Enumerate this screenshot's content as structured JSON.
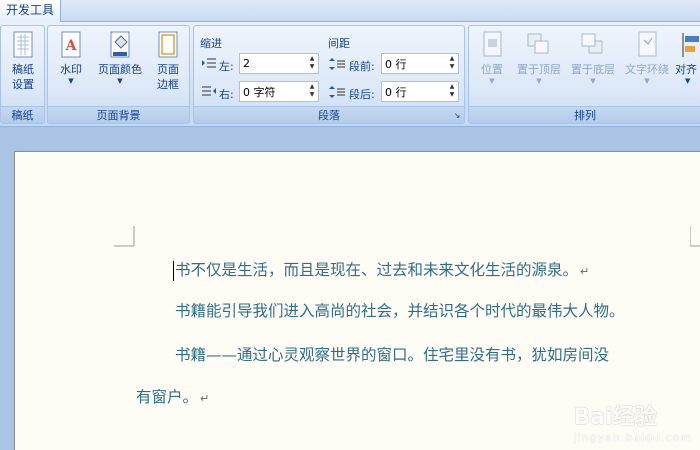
{
  "tabs": {
    "active": "开发工具"
  },
  "ribbon": {
    "draft_group": {
      "label": "稿纸",
      "draft_settings_line1": "稿纸",
      "draft_settings_line2": "设置"
    },
    "page_background_group": {
      "label": "页面背景",
      "watermark": "水印",
      "page_color": "页面颜色",
      "page_border_line1": "页面",
      "page_border_line2": "边框"
    },
    "paragraph_group": {
      "label": "段落",
      "indent_title": "缩进",
      "spacing_title": "间距",
      "indent_left_label": "左:",
      "indent_left_value": "2",
      "indent_right_label": "右:",
      "indent_right_value": "0 字符",
      "spacing_before_label": "段前:",
      "spacing_before_value": "0 行",
      "spacing_after_label": "段后:",
      "spacing_after_value": "0 行"
    },
    "arrange_group": {
      "label": "排列",
      "position": "位置",
      "bring_to_front": "置于顶层",
      "send_to_back": "置于底层",
      "text_wrapping": "文字环绕",
      "align": "对齐"
    }
  },
  "document": {
    "line1": "书不仅是生活，而且是现在、过去和未来文化生活的源泉。",
    "line2": "书籍能引导我们进入高尚的社会，并结识各个时代的最伟大人物。",
    "line3": "书籍——通过心灵观察世界的窗口。住宅里没有书，犹如房间没",
    "line4": "有窗户。",
    "para_mark": "↵"
  },
  "watermark": {
    "main": "Bai经验",
    "sub": "jingyan.baidu.com"
  },
  "colors": {
    "ribbon_text": "#15428b",
    "doc_text": "#2d6f88",
    "page_bg": "#fffcf6",
    "workspace_bg": "#abc3e4"
  }
}
